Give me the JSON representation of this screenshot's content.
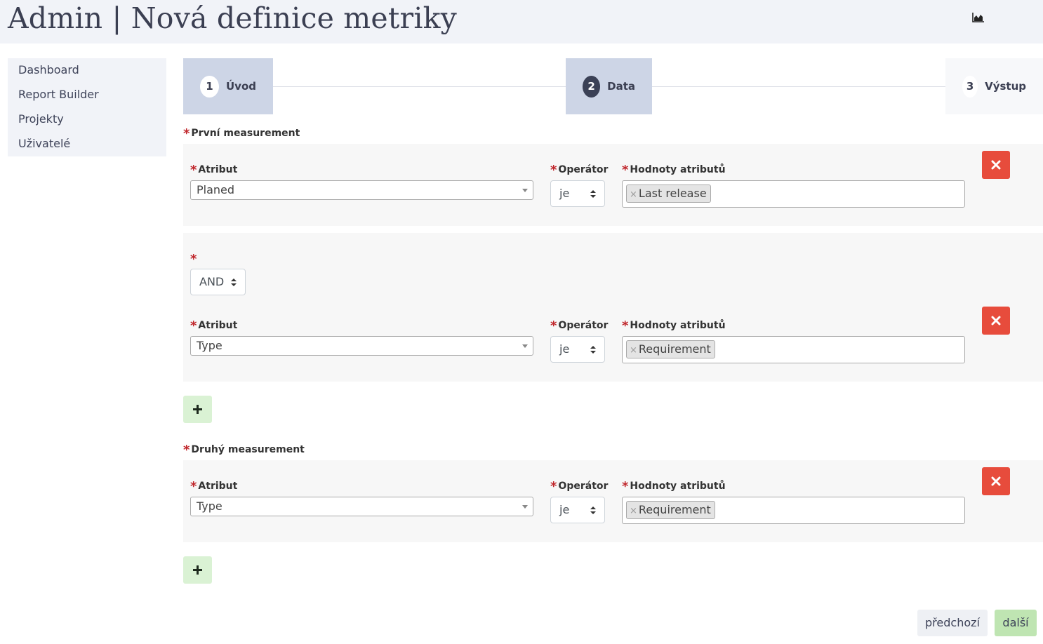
{
  "header": {
    "title": "Admin | Nová definice metriky",
    "icon": "area-chart-icon"
  },
  "sidebar": {
    "items": [
      {
        "label": "Dashboard"
      },
      {
        "label": "Report Builder"
      },
      {
        "label": "Projekty"
      },
      {
        "label": "Uživatelé"
      }
    ]
  },
  "steps": [
    {
      "number": "1",
      "label": "Úvod",
      "state": "done"
    },
    {
      "number": "2",
      "label": "Data",
      "state": "current"
    },
    {
      "number": "3",
      "label": "Výstup",
      "state": "upcoming"
    }
  ],
  "labels": {
    "required_mark": "*",
    "attribute": "Atribut",
    "operator": "Operátor",
    "attribute_values": "Hodnoty atributů",
    "tag_remove": "×"
  },
  "first_measurement": {
    "title": "První measurement",
    "conditions": [
      {
        "attribute": "Planed",
        "operator": "je",
        "values": [
          "Last release"
        ]
      },
      {
        "connector": "AND",
        "attribute": "Type",
        "operator": "je",
        "values": [
          "Requirement"
        ]
      }
    ]
  },
  "second_measurement": {
    "title": "Druhý measurement",
    "conditions": [
      {
        "attribute": "Type",
        "operator": "je",
        "values": [
          "Requirement"
        ]
      }
    ]
  },
  "footer": {
    "prev_label": "předchozí",
    "next_label": "další"
  },
  "colors": {
    "delete": "#e74c3c",
    "add": "#daf2d4",
    "next": "#bfe5b2",
    "step_active": "#cdd5e6",
    "required": "#c0262b"
  }
}
